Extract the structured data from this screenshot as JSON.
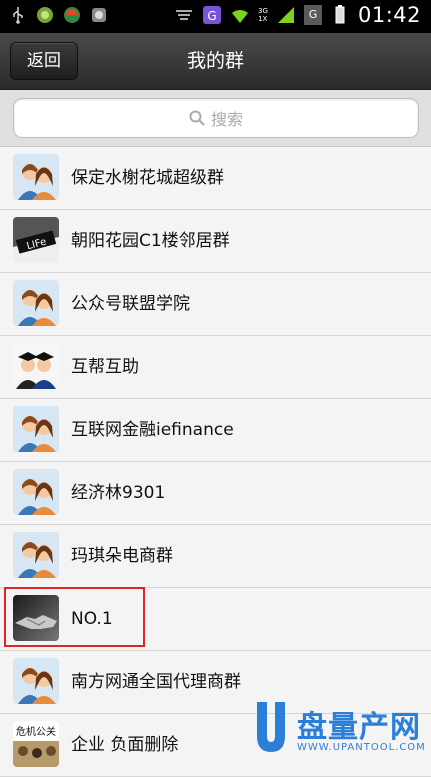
{
  "status_bar": {
    "time": "01:42",
    "icons": [
      "usb-icon",
      "app-icon-1",
      "app-icon-2",
      "app-icon-3",
      "bars-icon",
      "g-icon",
      "wifi-icon",
      "signal-3g-icon",
      "signal-g-icon",
      "battery-icon"
    ],
    "network_3g": "3G",
    "network_1x": "1X",
    "network_g": "G"
  },
  "navbar": {
    "back_label": "返回",
    "title": "我的群"
  },
  "search": {
    "placeholder": "搜索"
  },
  "groups": [
    {
      "name": "保定水榭花城超级群",
      "avatar": "default-group-avatar"
    },
    {
      "name": "朝阳花园C1楼邻居群",
      "avatar": "life-avatar",
      "avatar_text": "LIFe"
    },
    {
      "name": "公众号联盟学院",
      "avatar": "default-group-avatar"
    },
    {
      "name": "互帮互助",
      "avatar": "graduation-avatar"
    },
    {
      "name": "互联网金融iefinance",
      "avatar": "default-group-avatar"
    },
    {
      "name": "经济林9301",
      "avatar": "default-group-avatar"
    },
    {
      "name": "玛琪朵电商群",
      "avatar": "default-group-avatar"
    },
    {
      "name": "NO.1",
      "avatar": "handshake-avatar"
    },
    {
      "name": "南方网通全国代理商群",
      "avatar": "default-group-avatar"
    },
    {
      "name": "企业 负面删除",
      "avatar": "text-avatar",
      "avatar_text": "危机公关"
    }
  ],
  "watermark": {
    "brand": "盘量产网",
    "url": "WWW.UPANTOOL.COM",
    "accent": "#2c7fd8"
  },
  "colors": {
    "highlight_border": "#e0252a"
  }
}
